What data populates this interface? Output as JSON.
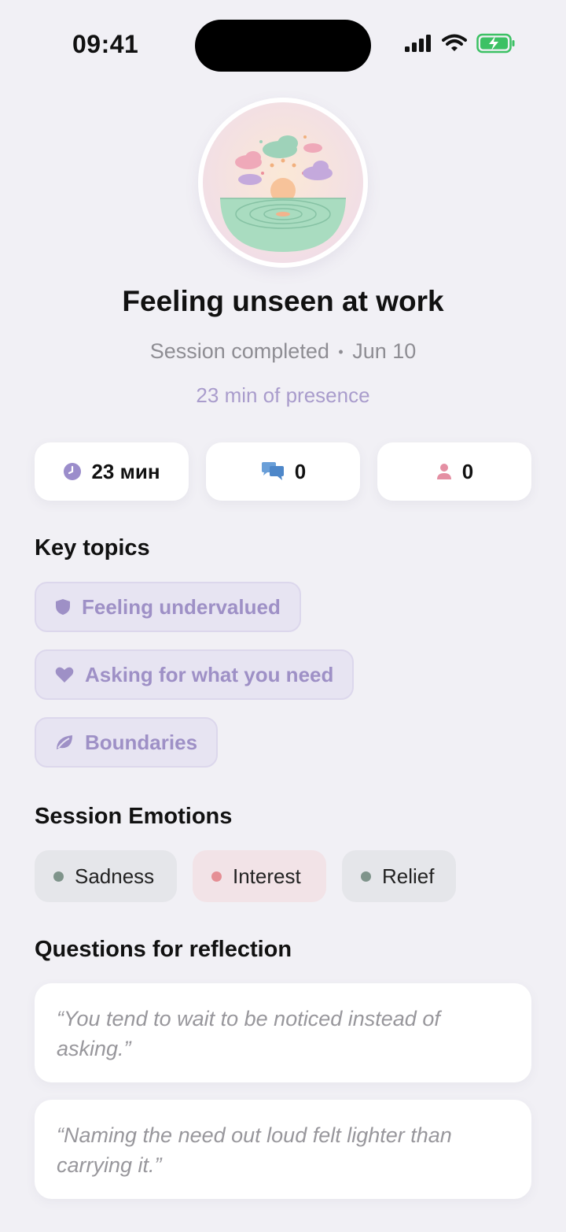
{
  "status_bar": {
    "time": "09:41"
  },
  "session": {
    "title": "Feeling unseen at work",
    "status": "Session completed",
    "separator": "•",
    "date": "Jun 10",
    "presence": "23 min of presence"
  },
  "stats": [
    {
      "icon": "clock-icon",
      "value": "23 мин"
    },
    {
      "icon": "chat-bubbles-icon",
      "value": "0"
    },
    {
      "icon": "person-icon",
      "value": "0"
    }
  ],
  "key_topics": {
    "title": "Key topics",
    "items": [
      {
        "icon": "shield-icon",
        "label": "Feeling undervalued"
      },
      {
        "icon": "heart-icon",
        "label": "Asking for what you need"
      },
      {
        "icon": "leaf-icon",
        "label": "Boundaries"
      }
    ]
  },
  "emotions": {
    "title": "Session Emotions",
    "items": [
      {
        "label": "Sadness",
        "dot_color": "#7f948b",
        "bg": "#e5e6ea"
      },
      {
        "label": "Interest",
        "dot_color": "#e58f95",
        "bg": "#f2e3e7"
      },
      {
        "label": "Relief",
        "dot_color": "#7f948b",
        "bg": "#e5e6ea"
      }
    ]
  },
  "reflection": {
    "title": "Questions for reflection",
    "quotes": [
      "“You tend to wait to be noticed instead of asking.”",
      "“Naming the need out loud felt lighter than carrying it.”"
    ]
  },
  "colors": {
    "background": "#f1f0f5",
    "accent": "#a99ccc",
    "topic_bg": "#e7e4f2"
  }
}
